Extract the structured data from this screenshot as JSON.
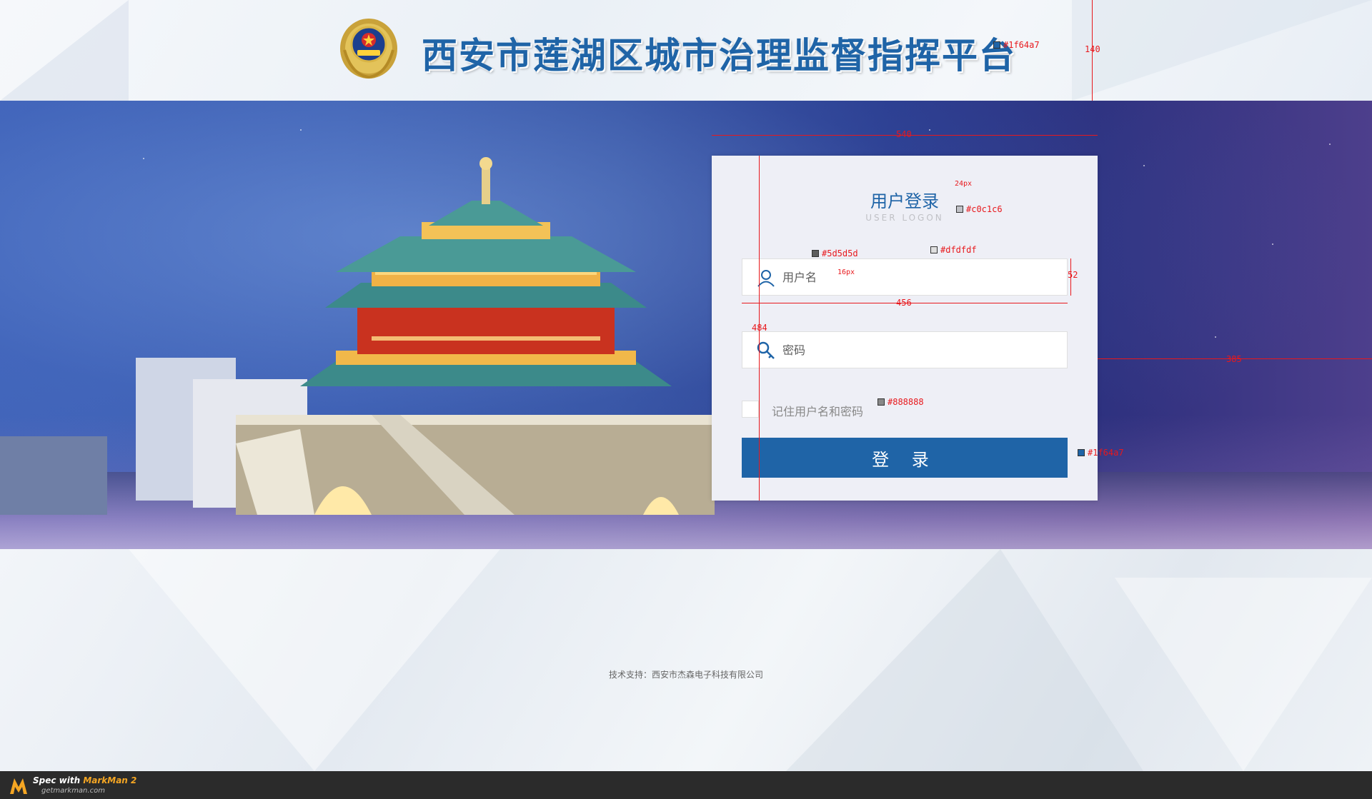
{
  "header": {
    "title": "西安市莲湖区城市治理监督指挥平台",
    "emblem_icon": "police-emblem-icon"
  },
  "login": {
    "title": "用户登录",
    "subtitle": "USER LOGON",
    "username_placeholder": "用户名",
    "password_placeholder": "密码",
    "remember_label": "记住用户名和密码",
    "submit_label": "登 录",
    "user_icon": "user-icon",
    "key_icon": "key-icon"
  },
  "annotations": {
    "title_color": "#1f64a7",
    "header_height": "140",
    "card_width": "540",
    "title_font_size": "24px",
    "subtitle_color": "#c0c1c6",
    "text_color": "#5d5d5d",
    "border_color": "#dfdfdf",
    "input_font_size": "16px",
    "input_height": "52",
    "input_width": "456",
    "card_height": "484",
    "right_offset": "385",
    "label_color": "#888888",
    "button_color": "#1f64a7"
  },
  "footer": {
    "support_text": "技术支持：西安市杰森电子科技有限公司"
  },
  "markman": {
    "spec_with": "Spec with ",
    "brand": "MarkMan 2",
    "url": "getmarkman.com"
  },
  "colors": {
    "brand_blue": "#1f64a7",
    "subtitle_gray": "#c0c1c6",
    "text_gray": "#5d5d5d",
    "border_gray": "#dfdfdf",
    "label_gray": "#888888"
  }
}
